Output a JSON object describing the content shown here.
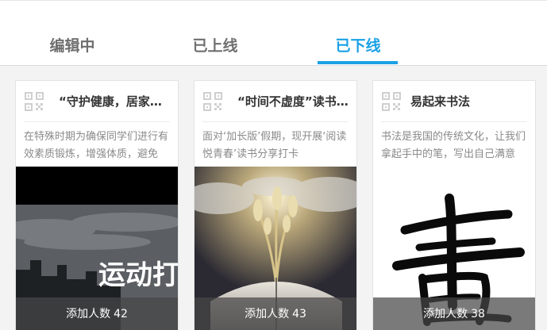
{
  "tabs": [
    {
      "label": "编辑中",
      "active": false
    },
    {
      "label": "已上线",
      "active": false
    },
    {
      "label": "已下线",
      "active": true
    }
  ],
  "accent_color": "#1aa1e6",
  "cards": [
    {
      "title": "“守护健康，居家锻炼”",
      "description": "在特殊时期为确保同学们进行有效素质锻炼，增强体质，避免",
      "image_text": "运动打卡",
      "added_label": "添加人数",
      "added_count": "42"
    },
    {
      "title": "“时间不虚度”读书分享",
      "description": "面对‘加长版’假期，现开展‘阅读悦青春’读书分享打卡",
      "added_label": "添加人数",
      "added_count": "43"
    },
    {
      "title": "易起来书法",
      "description": "书法是我国的传统文化，让我们拿起手中的笔，写出自己满意",
      "added_label": "添加人数",
      "added_count": "38"
    }
  ]
}
